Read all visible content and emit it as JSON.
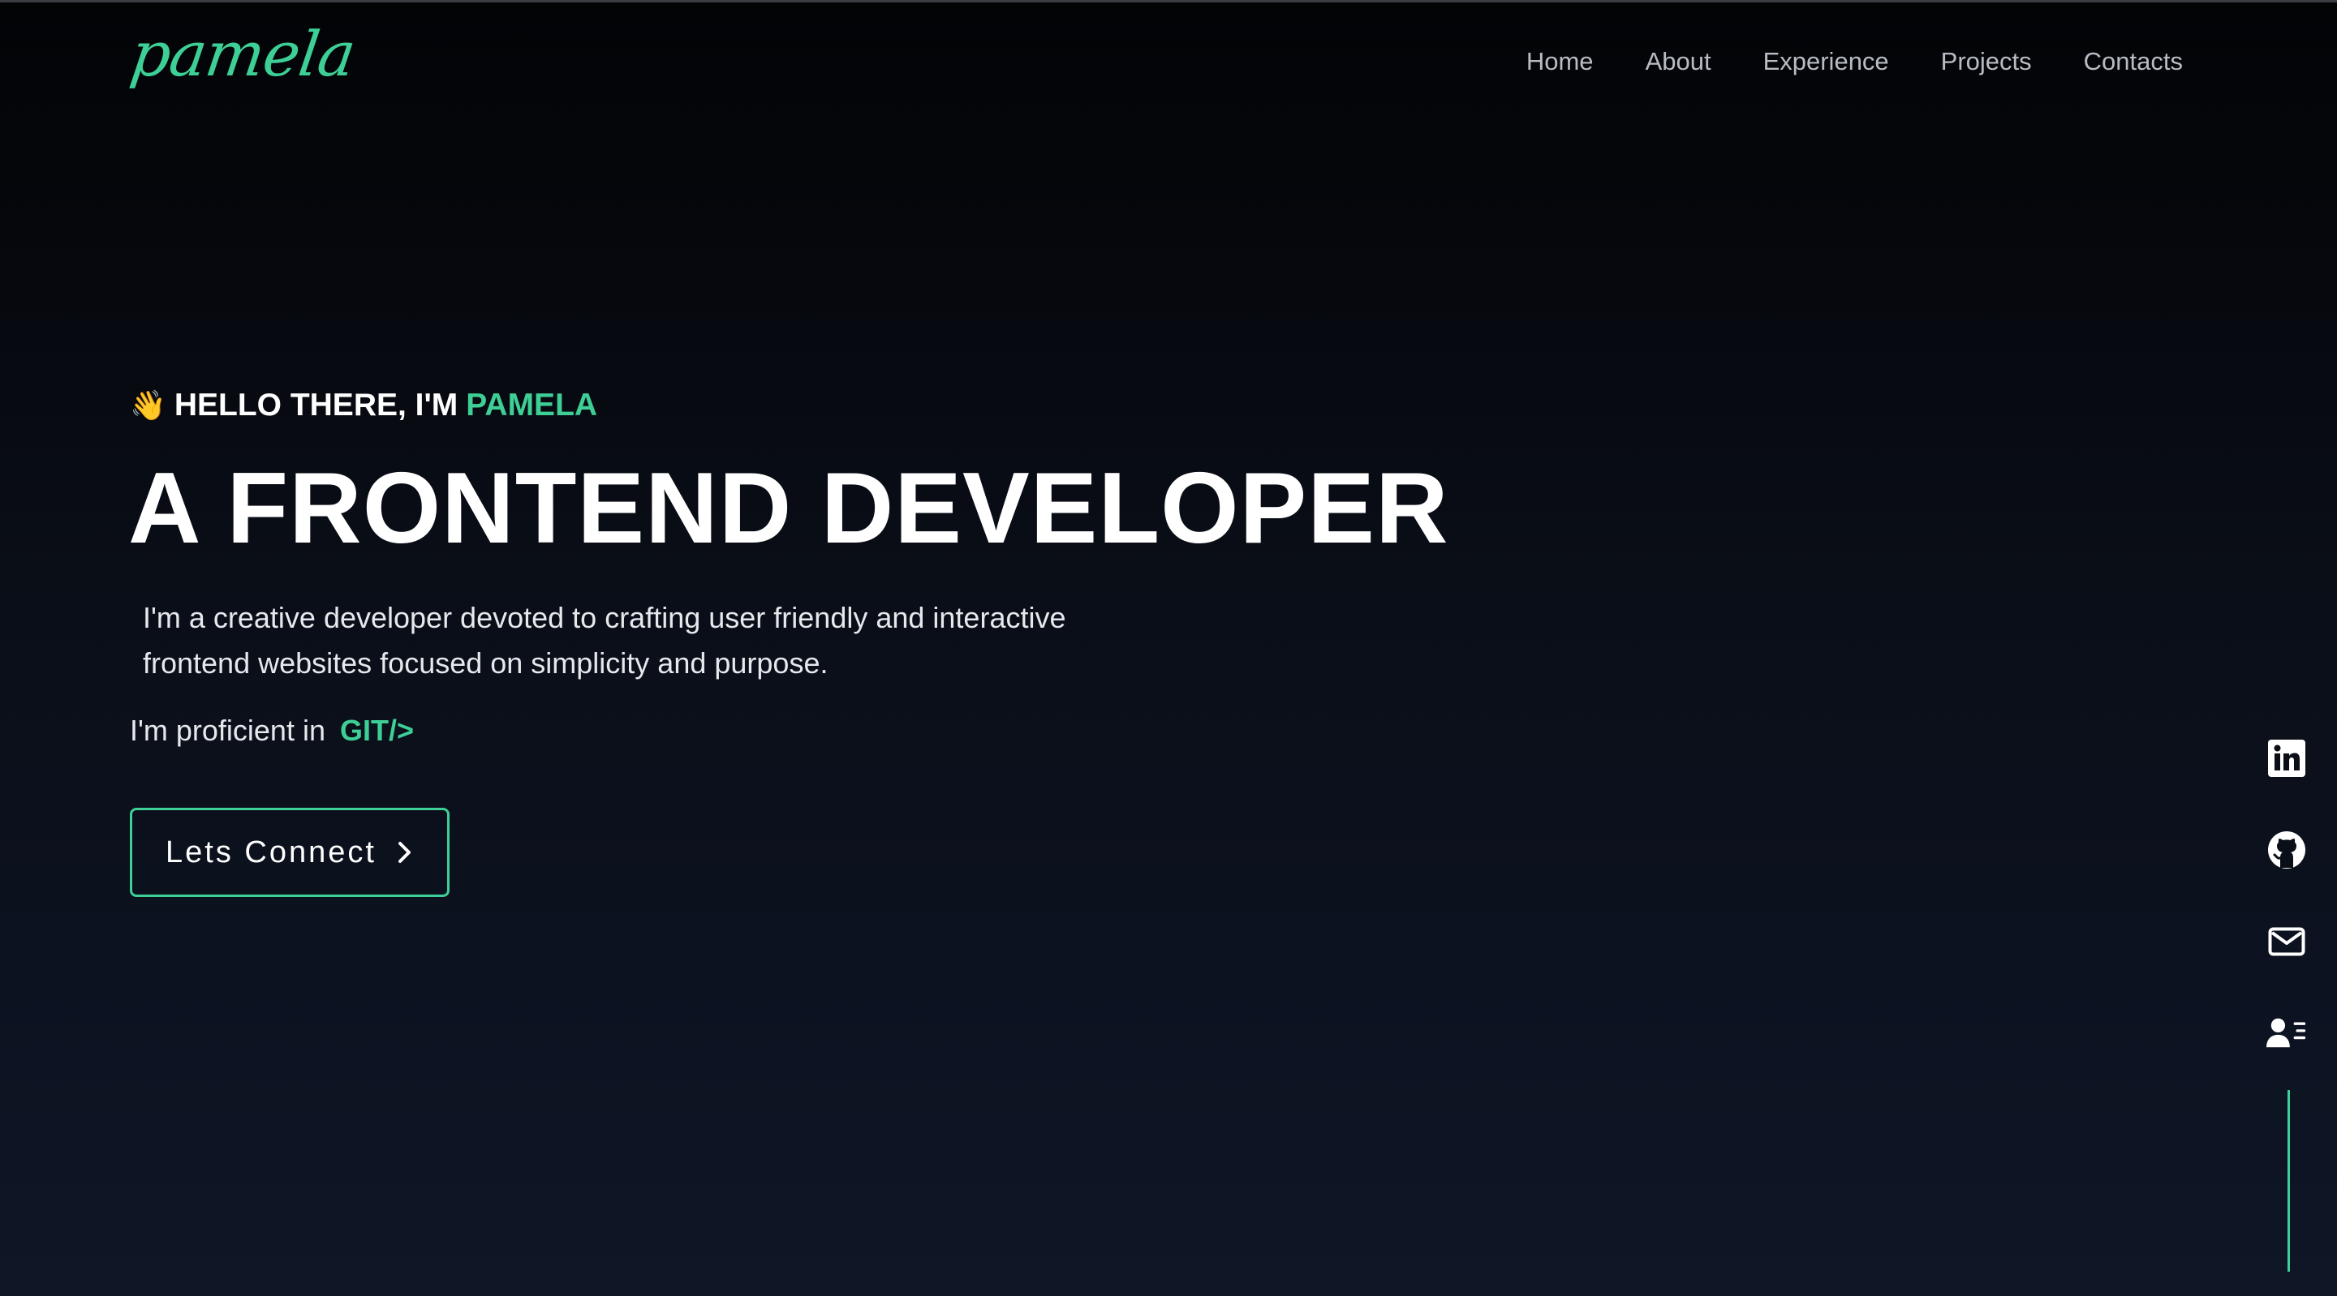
{
  "logo": {
    "text": "pamela"
  },
  "nav": {
    "items": [
      {
        "label": "Home"
      },
      {
        "label": "About"
      },
      {
        "label": "Experience"
      },
      {
        "label": "Projects"
      },
      {
        "label": "Contacts"
      }
    ]
  },
  "hero": {
    "wave_emoji": "👋",
    "greeting": "HELLO THERE, I'M",
    "name": "PAMELA",
    "headline": "A FRONTEND DEVELOPER",
    "description_line1": "I'm a creative developer devoted to crafting user friendly and interactive",
    "description_line2": "frontend websites focused on simplicity and purpose.",
    "proficient_prefix": "I'm proficient in",
    "proficient_skill": "GIT/>",
    "cta_label": "Lets Connect"
  },
  "social": {
    "icons": [
      "linkedin-icon",
      "github-icon",
      "mail-icon",
      "contact-card-icon"
    ]
  },
  "colors": {
    "accent": "#3ecf96",
    "background": "#0a0e17",
    "nav_text": "#b8bcc4",
    "text": "#ffffff"
  }
}
